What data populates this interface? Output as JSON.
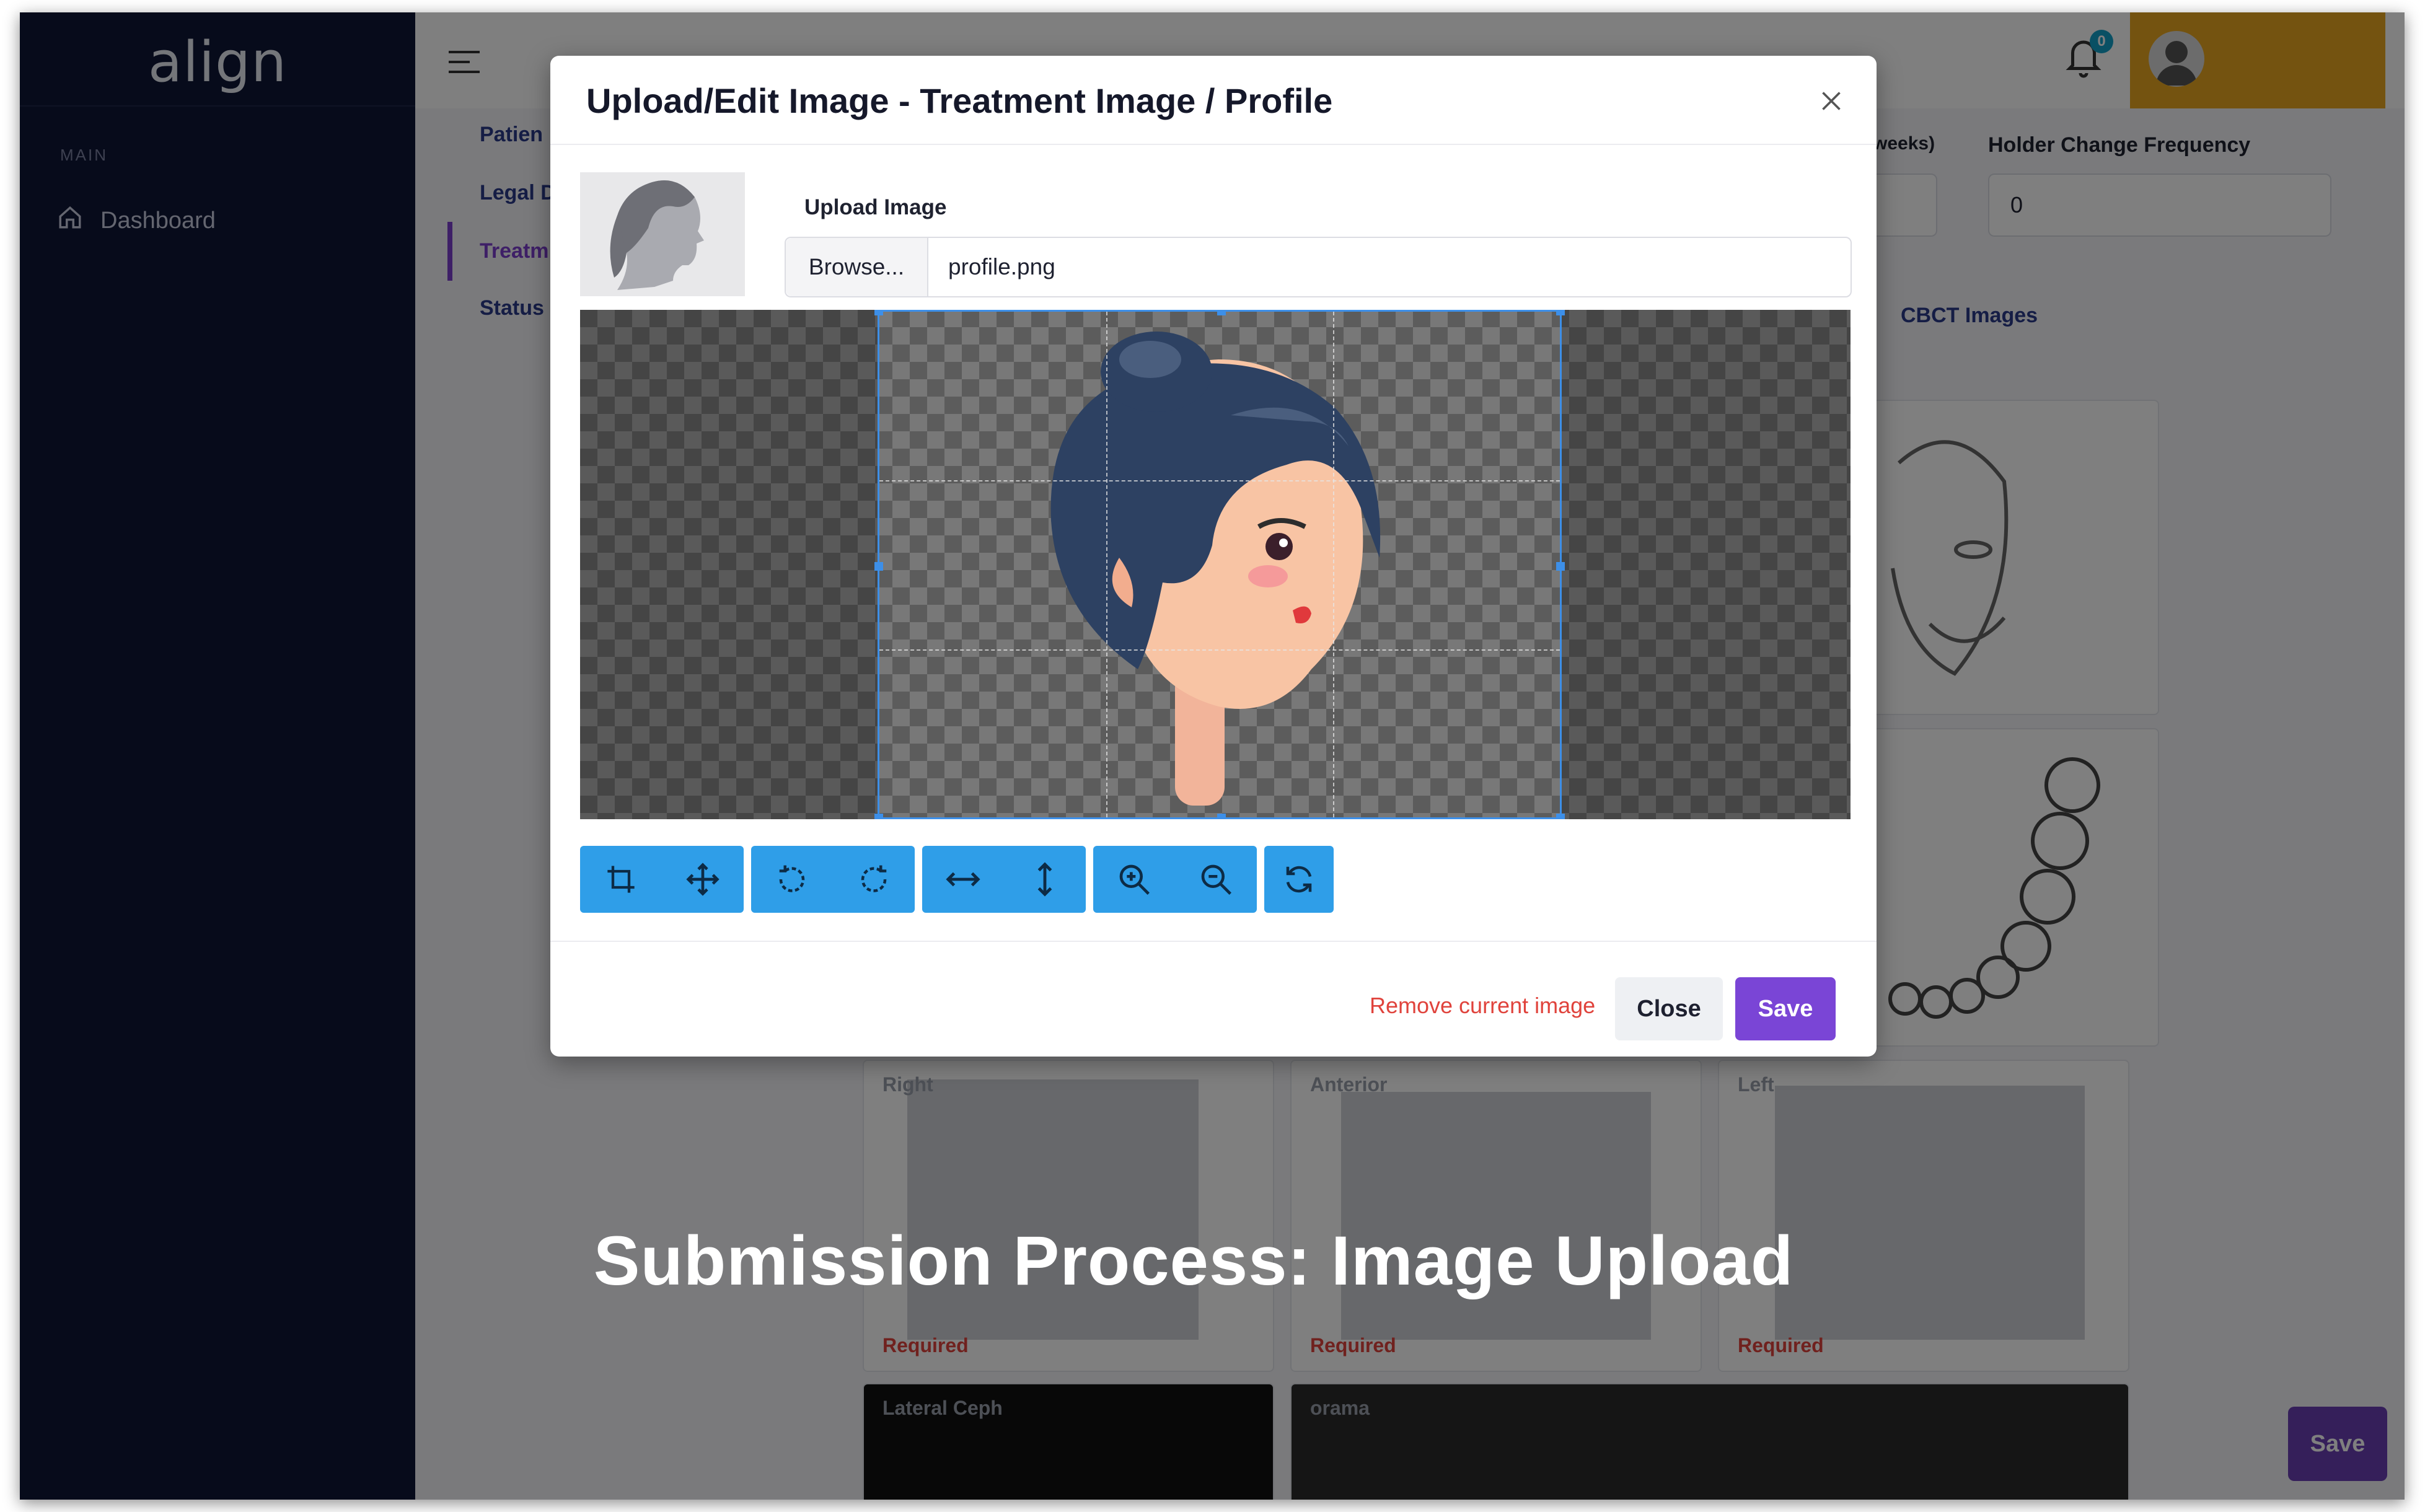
{
  "app": {
    "logo_text": "align",
    "sidebar": {
      "section_label": "MAIN",
      "items": [
        {
          "label": "Dashboard",
          "icon": "home-icon"
        }
      ]
    },
    "topbar": {
      "notification_count": "0",
      "accent_color": "#e9a620"
    }
  },
  "background": {
    "tabs": [
      "Patien",
      "Legal D",
      "Treatm",
      "Status"
    ],
    "fields": [
      {
        "label": "weeks)",
        "value": ""
      },
      {
        "label": "Holder Change Frequency",
        "value": "0"
      }
    ],
    "cbct_tab": "CBCT Images",
    "cards": [
      {
        "label": "Right",
        "required": "Required"
      },
      {
        "label": "Anterior",
        "required": "Required"
      },
      {
        "label": "Left",
        "required": "Required"
      },
      {
        "label": "Lateral Ceph",
        "required": ""
      },
      {
        "label": "orama",
        "required": ""
      }
    ],
    "save_label": "Save"
  },
  "modal": {
    "title": "Upload/Edit Image - Treatment Image / Profile",
    "upload_label": "Upload Image",
    "browse_label": "Browse...",
    "file_name": "profile.png",
    "toolbar_groups": [
      [
        "crop-icon",
        "move-icon"
      ],
      [
        "rotate-left-icon",
        "rotate-right-icon"
      ],
      [
        "flip-horizontal-icon",
        "flip-vertical-icon"
      ],
      [
        "zoom-in-icon",
        "zoom-out-icon"
      ],
      [
        "reset-icon"
      ]
    ],
    "remove_label": "Remove current image",
    "close_label": "Close",
    "save_label": "Save",
    "toolbar_color": "#2f9ee8",
    "save_color": "#7a45d6"
  },
  "caption": "Submission Process: Image Upload"
}
